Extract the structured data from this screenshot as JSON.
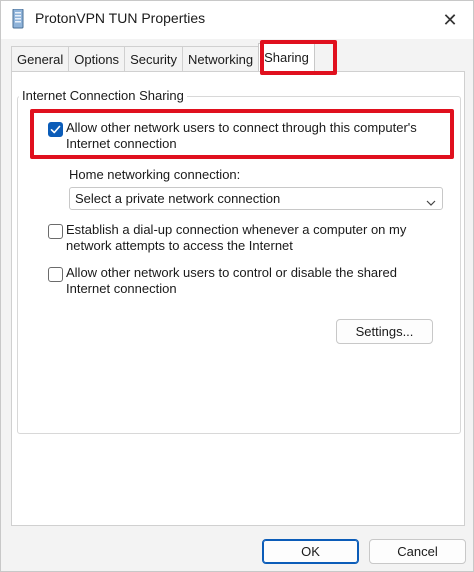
{
  "window": {
    "title": "ProtonVPN TUN Properties",
    "close_glyph": "✕",
    "icon": "network-adapter-icon"
  },
  "tabs": [
    {
      "label": "General",
      "active": false
    },
    {
      "label": "Options",
      "active": false
    },
    {
      "label": "Security",
      "active": false
    },
    {
      "label": "Networking",
      "active": false
    },
    {
      "label": "Sharing",
      "active": true
    }
  ],
  "sharing": {
    "group_label": "Internet Connection Sharing",
    "allow_connect": {
      "checked": true,
      "line1": "Allow other network users to connect through this computer's",
      "line2": "Internet connection"
    },
    "home_networking_label": "Home networking connection:",
    "home_networking_select": {
      "value": "Select a private network connection"
    },
    "dialup": {
      "checked": false,
      "line1": "Establish a dial-up connection whenever a computer on my",
      "line2": "network attempts to access the Internet"
    },
    "allow_control": {
      "checked": false,
      "line1": "Allow other network users to control or disable the shared",
      "line2": "Internet connection"
    },
    "settings_label": "Settings..."
  },
  "footer": {
    "ok_label": "OK",
    "cancel_label": "Cancel"
  },
  "colors": {
    "accent": "#0b5cb8",
    "highlight": "#e0101e"
  }
}
